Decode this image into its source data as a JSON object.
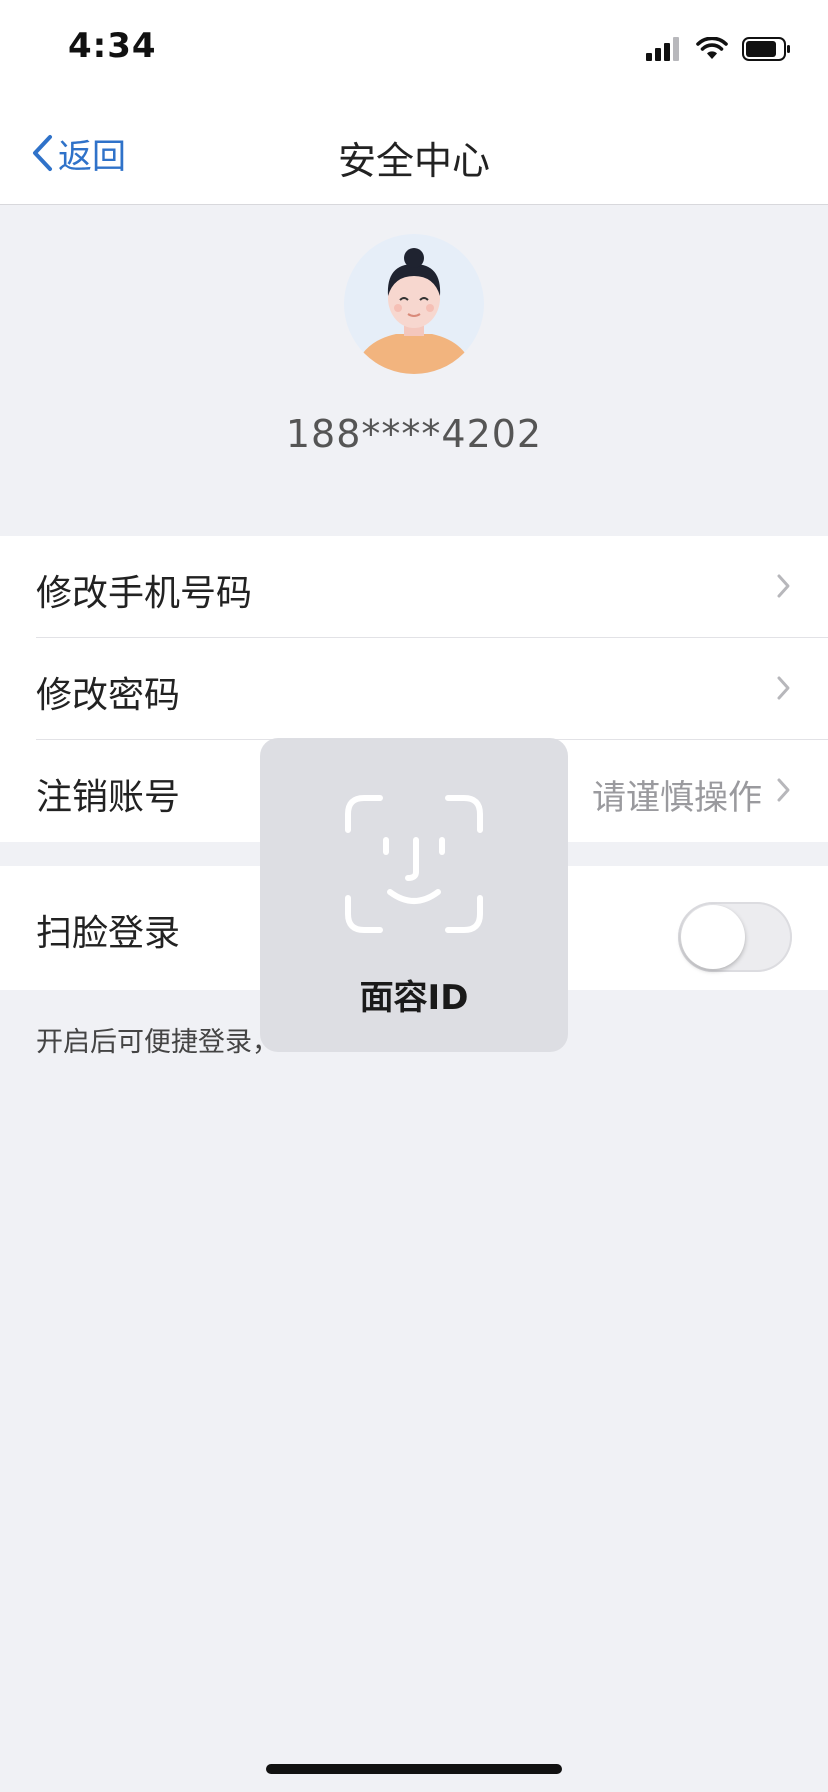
{
  "status_bar": {
    "time": "4:34",
    "icons": [
      "cellular-signal-icon",
      "wifi-icon",
      "battery-icon"
    ]
  },
  "nav": {
    "back_label": "返回",
    "title": "安全中心"
  },
  "profile": {
    "avatar": "avatar-illustration",
    "phone": "188****4202"
  },
  "settings": {
    "change_phone": "修改手机号码",
    "change_password": "修改密码",
    "delete_account": "注销账号",
    "delete_account_hint": "请谨慎操作",
    "face_login": "扫脸登录",
    "face_login_enabled": false,
    "footnote": "开启后可便捷登录，"
  },
  "faceid_overlay": {
    "label": "面容ID",
    "icon": "face-id-icon"
  },
  "colors": {
    "accent": "#2f72c9",
    "background": "#f0f1f5",
    "card": "#ffffff",
    "hint_text": "#9a9a9e"
  }
}
